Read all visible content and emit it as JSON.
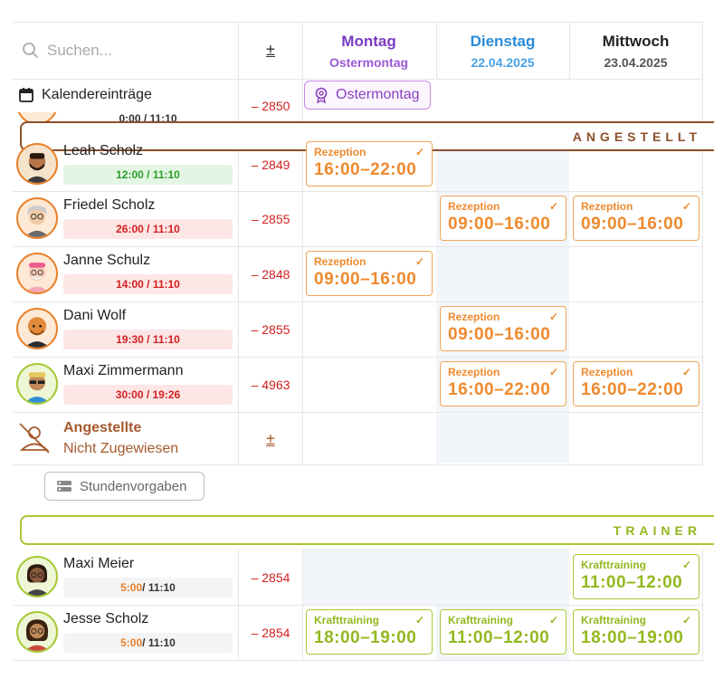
{
  "search": {
    "placeholder": "Suchen..."
  },
  "header": {
    "plus_minus": "±",
    "days": [
      {
        "name": "Montag",
        "sub": "Ostermontag"
      },
      {
        "name": "Dienstag",
        "sub": "22.04.2025"
      },
      {
        "name": "Mittwoch",
        "sub": "23.04.2025"
      }
    ]
  },
  "calendar": {
    "label": "Kalendereinträge",
    "holiday": "Ostermontag"
  },
  "partial_row": {
    "hours": "0:00 / 11:10",
    "diff": "– 2850"
  },
  "groups": {
    "angestellte": "ANGESTELLT",
    "trainer": "TRAINER"
  },
  "employees": [
    {
      "name": "Leah Scholz",
      "hours": "12:00 / 11:10",
      "diff": "– 2849"
    },
    {
      "name": "Friedel Scholz",
      "hours": "26:00 / 11:10",
      "diff": "– 2855"
    },
    {
      "name": "Janne Schulz",
      "hours": "14:00 / 11:10",
      "diff": "– 2848"
    },
    {
      "name": "Dani Wolf",
      "hours": "19:30 / 11:10",
      "diff": "– 2855"
    },
    {
      "name": "Maxi Zimmermann",
      "hours": "30:00 / 19:26",
      "diff": "– 4963"
    }
  ],
  "unassigned": {
    "title": "Angestellte",
    "subtitle": "Nicht Zugewiesen",
    "plus_minus": "±"
  },
  "standards_button": "Stundenvorgaben",
  "trainers": [
    {
      "name": "Maxi Meier",
      "hours_done": "5:00",
      "hours_target": " / 11:10",
      "diff": "– 2854"
    },
    {
      "name": "Jesse Scholz",
      "hours_done": "5:00",
      "hours_target": " / 11:10",
      "diff": "– 2854"
    }
  ],
  "shifts": {
    "rezeption": "Rezeption",
    "krafttraining": "Krafttraining",
    "s1": "16:00–22:00",
    "s2a": "09:00–16:00",
    "s2b": "09:00–16:00",
    "s3": "09:00–16:00",
    "s4": "09:00–16:00",
    "s5a": "16:00–22:00",
    "s5b": "16:00–22:00",
    "t1": "11:00–12:00",
    "t2a": "18:00–19:00",
    "t2b": "11:00–12:00",
    "t2c": "18:00–19:00"
  },
  "colors": {
    "purple": "#7a3cc4",
    "blue": "#2a8bd6",
    "orange": "#ee8a2e",
    "brown": "#8b4f2b",
    "lime": "#a6c835",
    "red": "#d21f1f"
  }
}
